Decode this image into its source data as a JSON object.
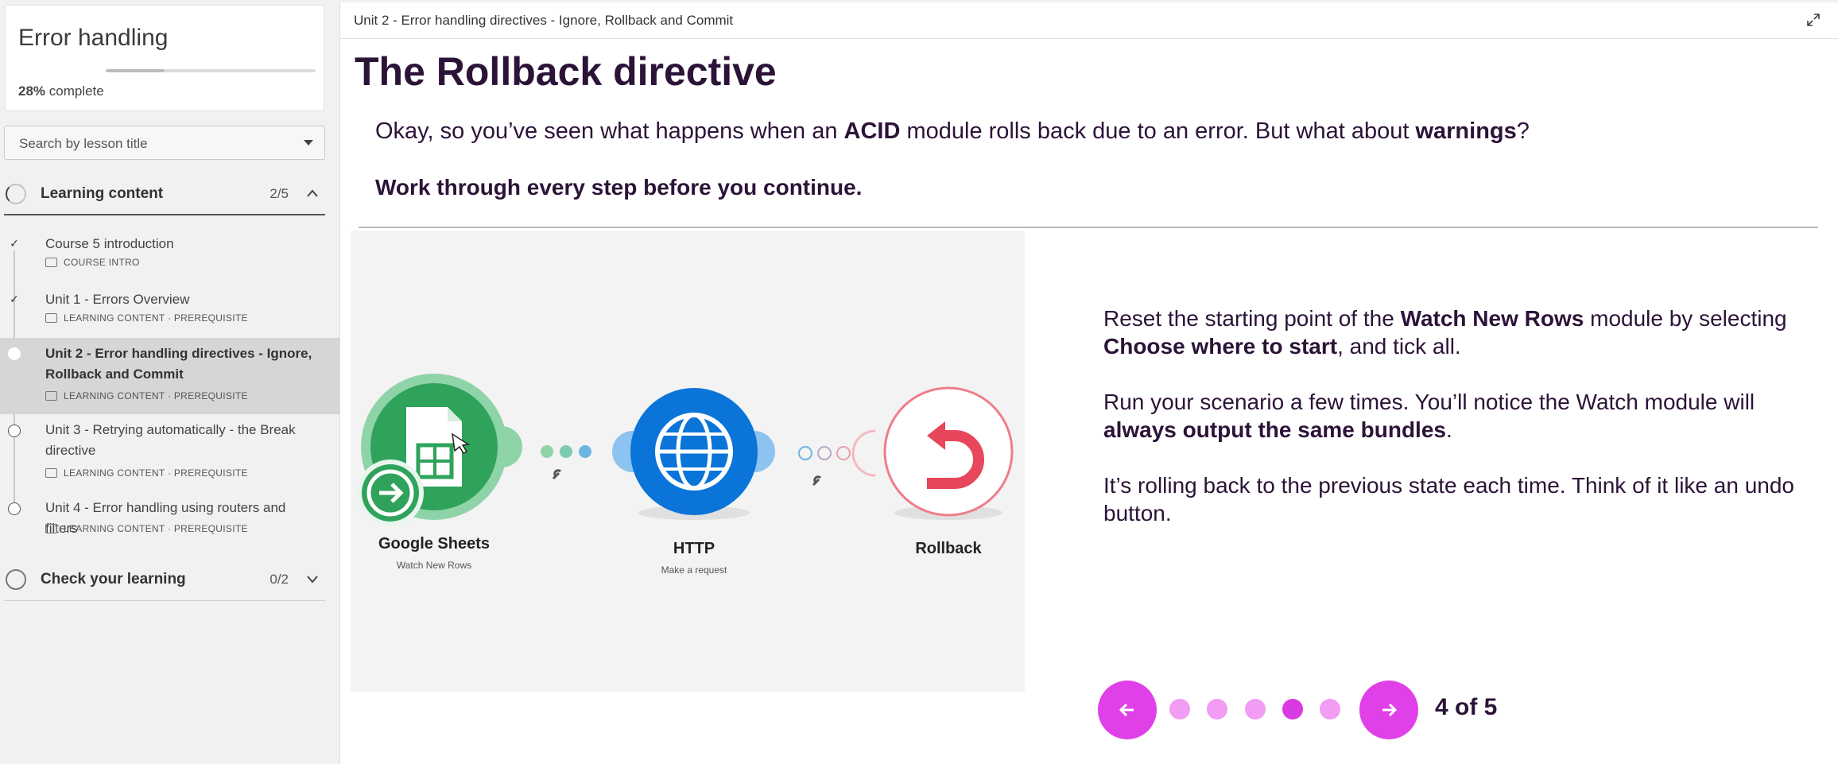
{
  "course": {
    "title": "Error handling",
    "progress_value": 0.28,
    "progress_pct": "28%",
    "progress_suffix": " complete"
  },
  "search": {
    "placeholder": "Search by lesson title"
  },
  "sections": [
    {
      "label": "Learning content",
      "count": "2/5",
      "state": "expanded"
    },
    {
      "label": "Check your learning",
      "count": "0/2",
      "state": "collapsed"
    }
  ],
  "lessons": [
    {
      "title": "Course 5 introduction",
      "meta": "COURSE INTRO",
      "status": "complete"
    },
    {
      "title": "Unit 1 - Errors Overview",
      "meta": "LEARNING CONTENT · PREREQUISITE",
      "status": "complete"
    },
    {
      "title": "Unit 2 - Error handling directives - Ignore, Rollback and Commit",
      "meta": "LEARNING CONTENT · PREREQUISITE",
      "status": "current"
    },
    {
      "title": "Unit 3 - Retrying automatically - the Break directive",
      "meta": "LEARNING CONTENT · PREREQUISITE",
      "status": "incomplete"
    },
    {
      "title": "Unit 4 - Error handling using routers and filters",
      "meta": "LEARNING CONTENT · PREREQUISITE",
      "status": "incomplete"
    }
  ],
  "header": {
    "breadcrumb": "Unit 2 - Error handling directives - Ignore, Rollback and Commit"
  },
  "page": {
    "title": "The Rollback directive",
    "intro_1": "Okay, so you’ve seen what happens when an ",
    "intro_b1": "ACID",
    "intro_2": " module rolls back due to an error. But what about ",
    "intro_b2": "warnings",
    "intro_3": "?",
    "instruction": "Work through every step before you continue."
  },
  "diagram": {
    "modules": [
      {
        "name": "Google Sheets",
        "sub": "Watch New Rows"
      },
      {
        "name": "HTTP",
        "sub": "Make a request"
      },
      {
        "name": "Rollback",
        "sub": ""
      }
    ]
  },
  "step": {
    "p1_a": "Reset the starting point of the ",
    "p1_b": "Watch New Rows",
    "p1_c": " module by selecting ",
    "p1_d": "Choose where to start",
    "p1_e": ", and tick all.",
    "p2_a": "Run your scenario a few times. You’ll notice the Watch module will ",
    "p2_b": "always output the same bundles",
    "p2_c": ".",
    "p3": "It’s rolling back to the previous state each time. Think of it like an undo button."
  },
  "pager": {
    "label": "4 of 5",
    "current": 4,
    "total": 5
  },
  "colors": {
    "accent": "#e040e8",
    "heading": "#2c1338",
    "sheets_green": "#2fa35b",
    "http_blue": "#0b74d8",
    "rollback_red": "#e8465a"
  }
}
